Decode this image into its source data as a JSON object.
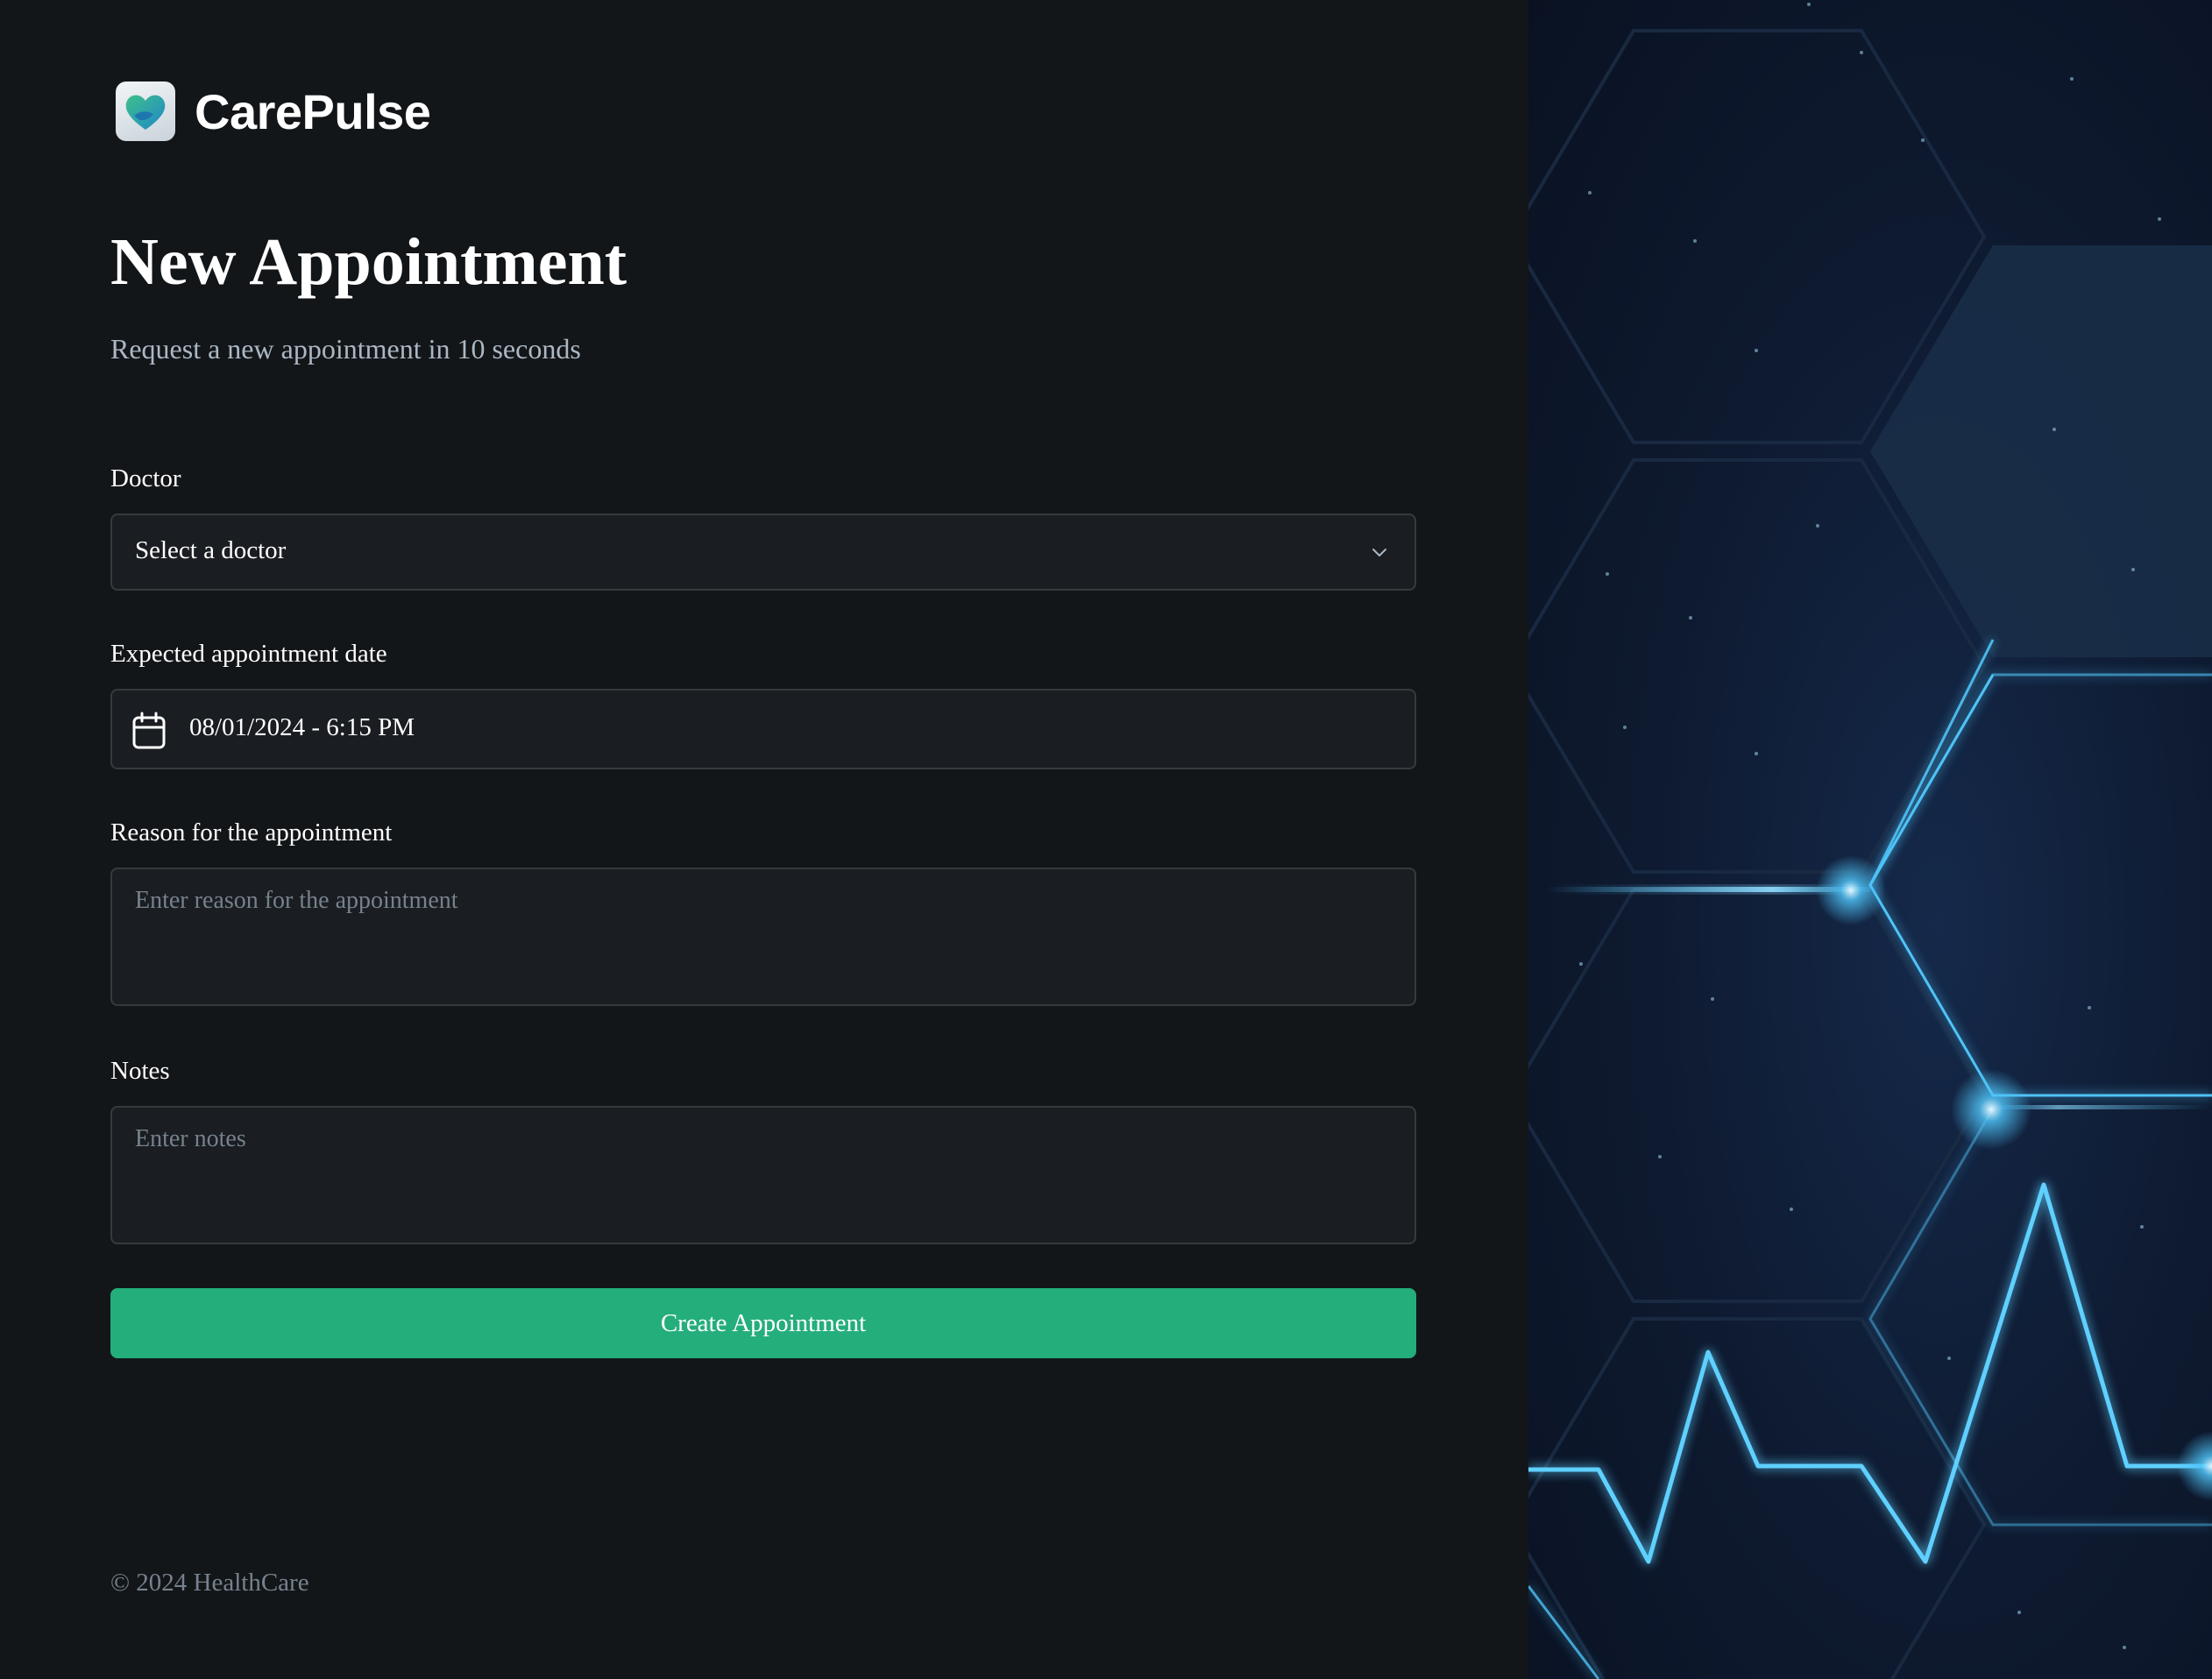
{
  "brand": {
    "name": "CarePulse"
  },
  "header": {
    "title": "New Appointment",
    "subtitle": "Request a new appointment in 10 seconds"
  },
  "form": {
    "doctor": {
      "label": "Doctor",
      "value": "Select a doctor",
      "icon": "chevron-down-icon"
    },
    "date": {
      "label": "Expected appointment date",
      "value": "08/01/2024 - 6:15 PM",
      "icon": "calendar-icon"
    },
    "reason": {
      "label": "Reason for the appointment",
      "placeholder": "Enter reason for the appointment"
    },
    "notes": {
      "label": "Notes",
      "placeholder": "Enter notes"
    },
    "submit_label": "Create Appointment"
  },
  "footer": {
    "copyright": "© 2024 HealthCare"
  },
  "colors": {
    "accent": "#24ae7c",
    "background": "#131619",
    "field": "#1a1d21",
    "border": "#363a3d",
    "muted": "#76828d",
    "glow": "#4fc3f7"
  }
}
